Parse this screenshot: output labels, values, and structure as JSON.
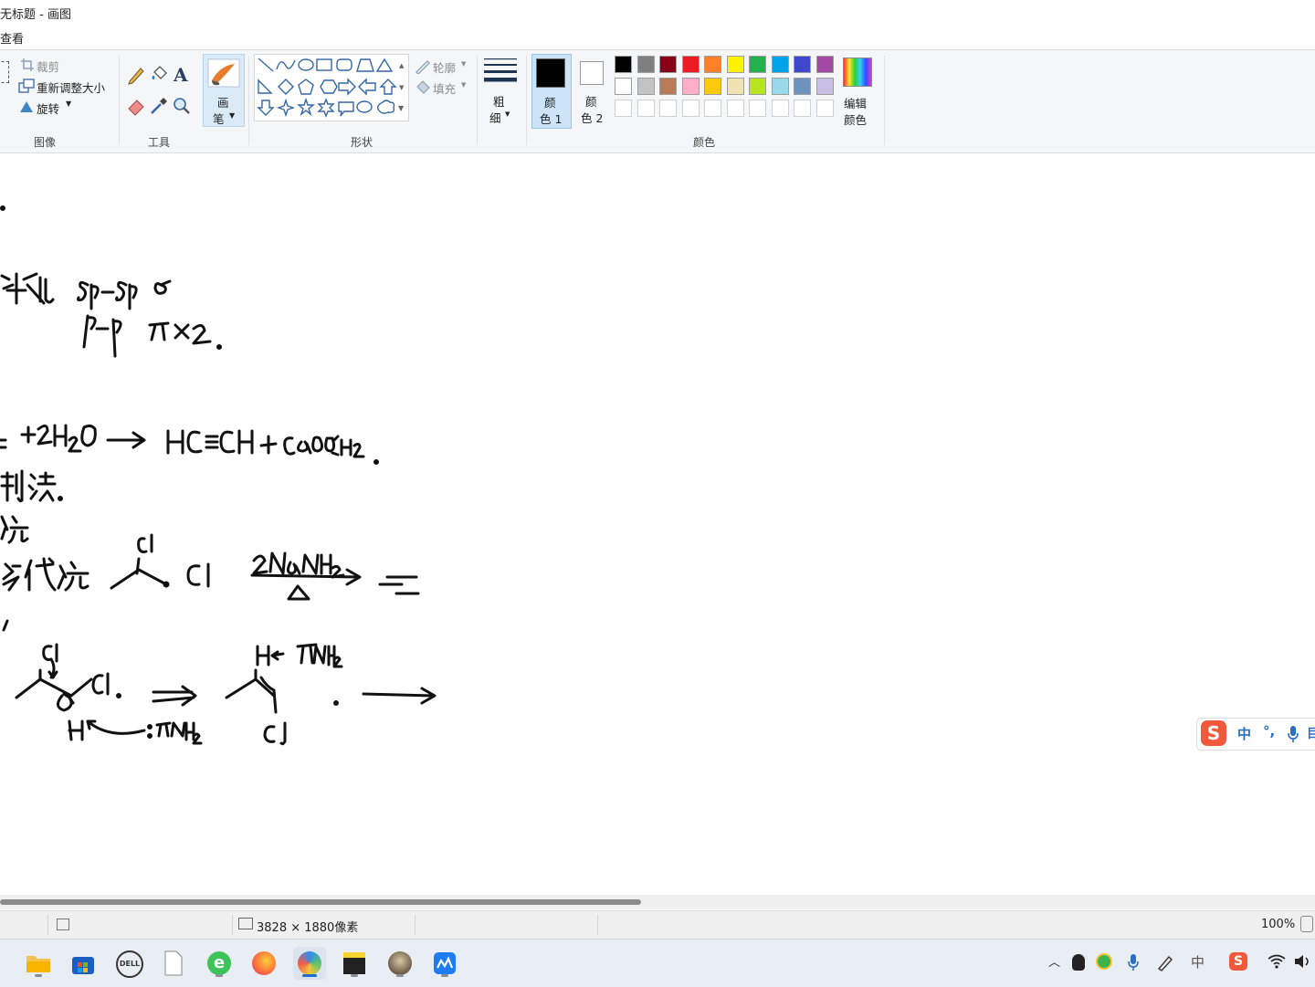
{
  "window": {
    "title": "无标题 - 画图"
  },
  "menu": {
    "view_label": "查看"
  },
  "ribbon": {
    "image": {
      "group_label": "图像",
      "crop_label": "裁剪",
      "resize_label": "重新调整大小",
      "rotate_label": "旋转"
    },
    "tools": {
      "group_label": "工具",
      "icons": [
        "pencil-icon",
        "fill-icon",
        "text-icon",
        "eraser-icon",
        "color-picker-icon",
        "magnifier-icon"
      ]
    },
    "brushes": {
      "label_line1": "画",
      "label_line2": "笔"
    },
    "shapes": {
      "group_label": "形状",
      "outline_label": "轮廓",
      "fill_label": "填充",
      "items": [
        "line",
        "curve",
        "oval",
        "rectangle",
        "rounded-rectangle",
        "polygon",
        "triangle",
        "right-triangle",
        "diamond",
        "pentagon",
        "hexagon",
        "right-arrow",
        "left-arrow",
        "up-arrow",
        "down-arrow",
        "four-point-star",
        "five-point-star",
        "six-point-star",
        "rounded-callout",
        "oval-callout",
        "cloud-callout"
      ]
    },
    "size": {
      "label_line1": "粗",
      "label_line2": "细"
    },
    "color1": {
      "label_line1": "颜",
      "label_line2": "色 1",
      "value": "#000000"
    },
    "color2": {
      "label_line1": "颜",
      "label_line2": "色 2",
      "value": "#ffffff"
    },
    "colors": {
      "group_label": "颜色",
      "palette_row1": [
        "#000000",
        "#7f7f7f",
        "#880015",
        "#ed1c24",
        "#ff7f27",
        "#fff200",
        "#22b14c",
        "#00a2e8",
        "#3f48cc",
        "#a349a4"
      ],
      "palette_row2": [
        "#ffffff",
        "#c3c3c3",
        "#b97a57",
        "#ffaec9",
        "#ffc90e",
        "#efe4b0",
        "#b5e61d",
        "#99d9ea",
        "#7092be",
        "#c8bfe7"
      ],
      "palette_row3_count": 10,
      "edit_label_line1": "编辑",
      "edit_label_line2": "颜色"
    }
  },
  "canvas": {
    "handwriting_lines": [
      ".",
      "杂化 sp-sp σ",
      "p-p π×2.",
      "+2H₂O ⟶ HC≡CH + Ca(OH)₂.",
      "制法.",
      "烷",
      "多代烷",
      "Cl",
      "Cl",
      "2NaNH₂",
      "△",
      "≡",
      "Cl",
      "Cl.",
      "H←NH₂",
      ":NH₂",
      "H",
      "Cl"
    ]
  },
  "ime": {
    "mode_label": "中",
    "punct_label": "°,",
    "extra_label": "目"
  },
  "statusbar": {
    "dimensions": "3828 × 1880像素",
    "zoom": "100%"
  },
  "taskbar": {
    "apps": [
      "file-explorer",
      "microsoft-store",
      "dell",
      "blank-document",
      "browser",
      "firefox",
      "paint",
      "sticky-notes",
      "photo-app",
      "meeting-app"
    ],
    "active_app": "paint",
    "tray": {
      "ime_label": "中"
    }
  }
}
